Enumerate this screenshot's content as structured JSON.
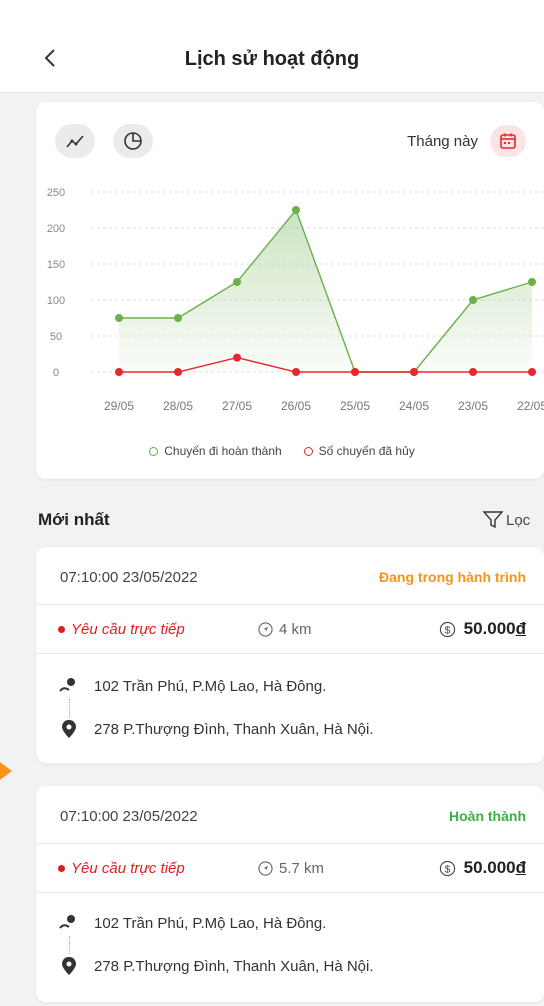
{
  "header": {
    "title": "Lịch sử hoạt động"
  },
  "chart_card": {
    "filter_label": "Tháng này"
  },
  "chart_data": {
    "type": "line",
    "categories": [
      "29/05",
      "28/05",
      "27/05",
      "26/05",
      "25/05",
      "24/05",
      "23/05",
      "22/05"
    ],
    "series": [
      {
        "name": "Chuyến đi hoàn thành",
        "values": [
          75,
          75,
          125,
          225,
          0,
          0,
          100,
          125
        ],
        "color": "#6ab04c"
      },
      {
        "name": "Số chuyến đã hủy",
        "values": [
          0,
          0,
          20,
          0,
          0,
          0,
          0,
          0
        ],
        "color": "#e8262b"
      }
    ],
    "yticks": [
      "250",
      "200",
      "150",
      "100",
      "50",
      "0"
    ],
    "ylim": [
      0,
      250
    ],
    "grid": true,
    "legend_position": "bottom"
  },
  "section": {
    "title": "Mới nhất",
    "filter_label": "Lọc"
  },
  "trips": [
    {
      "time": "07:10:00  23/05/2022",
      "status": "Đang trong hành trình",
      "request_type": "Yêu cầu trực tiếp",
      "distance": "4 km",
      "price": "50.000",
      "currency": "đ",
      "pickup": "102 Trần Phú, P.Mộ Lao, Hà Đông.",
      "dropoff": "278 P.Thượng Đình, Thanh Xuân, Hà Nội."
    },
    {
      "time": "07:10:00  23/05/2022",
      "status": "Hoàn thành",
      "request_type": "Yêu cầu trực tiếp",
      "distance": "5.7 km",
      "price": "50.000",
      "currency": "đ",
      "pickup": "102 Trần Phú, P.Mộ Lao, Hà Đông.",
      "dropoff": "278 P.Thượng Đình, Thanh Xuân, Hà Nội."
    }
  ],
  "colors": {
    "orange": "#f7941d",
    "green": "#3cb043",
    "red": "#e01d1d"
  }
}
